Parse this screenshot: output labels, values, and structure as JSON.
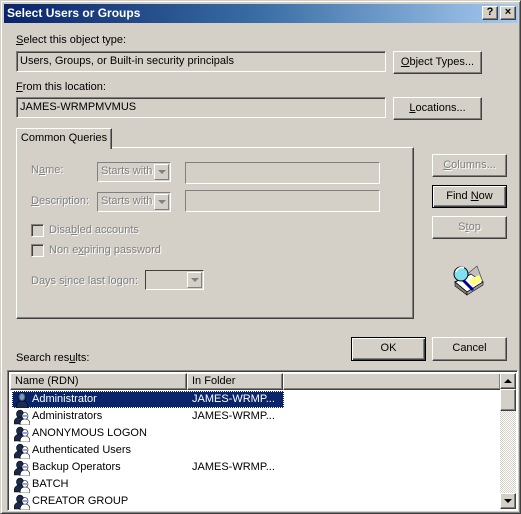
{
  "window": {
    "title": "Select Users or Groups",
    "help_button": "?",
    "close_button": "×"
  },
  "object_type": {
    "label_prefix": "",
    "label_accel": "S",
    "label_rest": "elect this object type:",
    "value": "Users, Groups, or Built-in security principals",
    "button_accel": "O",
    "button_rest": "bject Types..."
  },
  "location": {
    "label_accel": "F",
    "label_rest": "rom this location:",
    "value": "JAMES-WRMPMVMUS",
    "button_accel": "L",
    "button_rest": "ocations..."
  },
  "common_queries": {
    "tab_label": "Common Queries",
    "name": {
      "label_pre": "N",
      "label_accel": "a",
      "label_post": "me:",
      "operator": "Starts with",
      "value": ""
    },
    "description": {
      "label_accel": "D",
      "label_post": "escription:",
      "operator": "Starts with",
      "value": ""
    },
    "disabled_accounts": {
      "label_pre": "Disa",
      "label_accel": "b",
      "label_post": "led accounts",
      "checked": false
    },
    "non_expiring_password": {
      "label_pre": "Non e",
      "label_accel": "x",
      "label_post": "piring password",
      "checked": false
    },
    "days_since_logon": {
      "label_pre": "Days s",
      "label_accel": "i",
      "label_post": "nce last logon:",
      "value": ""
    }
  },
  "side_buttons": {
    "columns_accel": "C",
    "columns_rest": "olumns...",
    "find_now_pre": "Find ",
    "find_now_accel": "N",
    "find_now_post": "ow",
    "stop_pre": "S",
    "stop_accel": "t",
    "stop_post": "op"
  },
  "dialog_buttons": {
    "ok": "OK",
    "cancel": "Cancel"
  },
  "search_results": {
    "label_pre": "Search res",
    "label_accel": "u",
    "label_post": "lts:",
    "columns": [
      "Name (RDN)",
      "In Folder"
    ],
    "rows": [
      {
        "name": "Administrator",
        "folder": "JAMES-WRMP...",
        "icon": "user-icon",
        "selected": true
      },
      {
        "name": "Administrators",
        "folder": "JAMES-WRMP...",
        "icon": "group-icon",
        "selected": false
      },
      {
        "name": "ANONYMOUS LOGON",
        "folder": "",
        "icon": "group-icon",
        "selected": false
      },
      {
        "name": "Authenticated Users",
        "folder": "",
        "icon": "group-icon",
        "selected": false
      },
      {
        "name": "Backup Operators",
        "folder": "JAMES-WRMP...",
        "icon": "group-icon",
        "selected": false
      },
      {
        "name": "BATCH",
        "folder": "",
        "icon": "group-icon",
        "selected": false
      },
      {
        "name": "CREATOR GROUP",
        "folder": "",
        "icon": "group-icon",
        "selected": false
      }
    ]
  }
}
